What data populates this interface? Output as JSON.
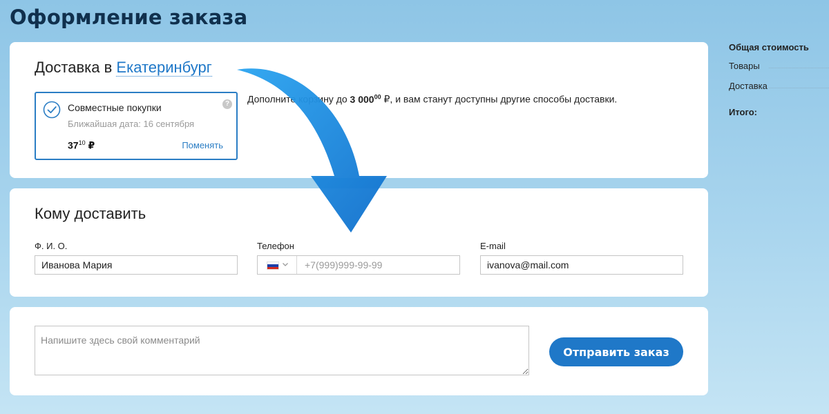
{
  "page": {
    "title": "Оформление заказа"
  },
  "delivery": {
    "heading_prefix": "Доставка в",
    "city": "Екатеринбург",
    "option": {
      "name": "Совместные покупки",
      "nearest_date": "Ближайшая дата: 16 сентября",
      "price_main": "37",
      "price_fraction": "10",
      "currency": "₽",
      "change_label": "Поменять",
      "help_symbol": "?",
      "selected": true
    },
    "promo": {
      "before": "Дополните корзину до",
      "amount": "3 000",
      "amount_fraction": "00",
      "currency": "₽",
      "after": ", и вам станут доступны другие способы доставки."
    }
  },
  "recipient": {
    "heading": "Кому доставить",
    "name_label": "Ф. И. О.",
    "name_value": "Иванова Мария",
    "phone_label": "Телефон",
    "phone_placeholder": "+7(999)999-99-99",
    "phone_country": "russia-flag-icon",
    "email_label": "E-mail",
    "email_value": "ivanova@mail.com"
  },
  "comment": {
    "placeholder": "Напишите здесь свой комментарий",
    "submit_label": "Отправить заказ"
  },
  "summary": {
    "title": "Общая стоимость",
    "goods_label": "Товары",
    "delivery_label": "Доставка",
    "total_label": "Итого:"
  },
  "colors": {
    "accent": "#1f78c8",
    "page_background": "#a9d5ee",
    "title": "#10304d",
    "annotation_arrow": "#1a8ae0"
  }
}
